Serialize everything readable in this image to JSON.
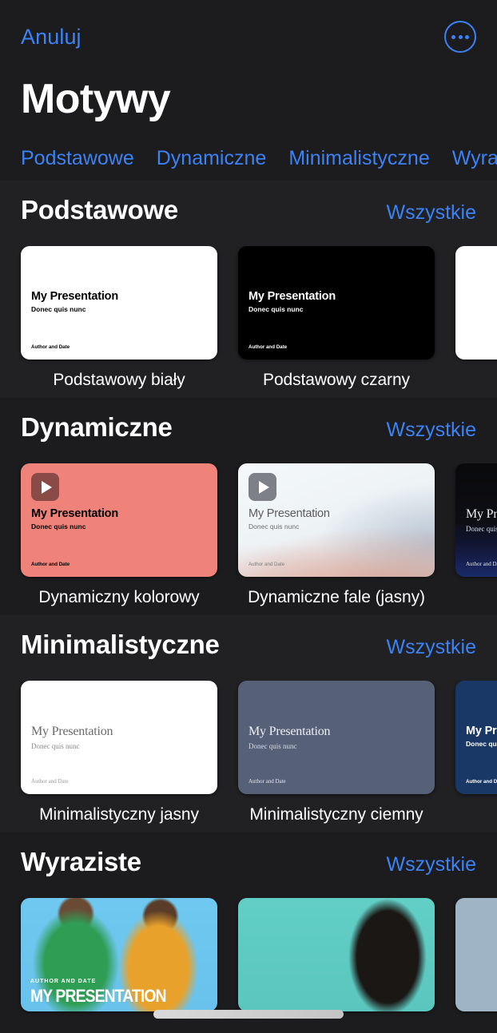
{
  "navbar": {
    "cancel_label": "Anuluj",
    "more_icon": "more-circle-icon"
  },
  "page_title": "Motywy",
  "tabs": [
    {
      "label": "Podstawowe"
    },
    {
      "label": "Dynamiczne"
    },
    {
      "label": "Minimalistyczne"
    },
    {
      "label": "Wyraziste"
    }
  ],
  "see_all_label": "Wszystkie",
  "slide_text": {
    "title": "My Presentation",
    "subtitle": "Donec quis nunc",
    "author": "Author and Date",
    "bold_title": "MY PRESENTATION",
    "bold_kicker": "AUTHOR AND DATE"
  },
  "colors": {
    "accent": "#3b82f6",
    "background": "#1c1c1e",
    "section_alt_background": "#212124",
    "text": "#ffffff",
    "coral": "#ef8279",
    "slate": "#566178",
    "navy": "#1a3866"
  },
  "sections": [
    {
      "title": "Podstawowe",
      "all_label": "Wszystkie",
      "cards": [
        {
          "label": "Podstawowy biały"
        },
        {
          "label": "Podstawowy czarny"
        },
        {
          "label": ""
        }
      ]
    },
    {
      "title": "Dynamiczne",
      "all_label": "Wszystkie",
      "cards": [
        {
          "label": "Dynamiczny kolorowy"
        },
        {
          "label": "Dynamiczne fale (jasny)"
        },
        {
          "label": ""
        }
      ]
    },
    {
      "title": "Minimalistyczne",
      "all_label": "Wszystkie",
      "cards": [
        {
          "label": "Minimalistyczny jasny"
        },
        {
          "label": "Minimalistyczny ciemny"
        },
        {
          "label": ""
        }
      ]
    },
    {
      "title": "Wyraziste",
      "all_label": "Wszystkie",
      "cards": [
        {
          "label": ""
        },
        {
          "label": ""
        },
        {
          "label": ""
        }
      ]
    }
  ]
}
